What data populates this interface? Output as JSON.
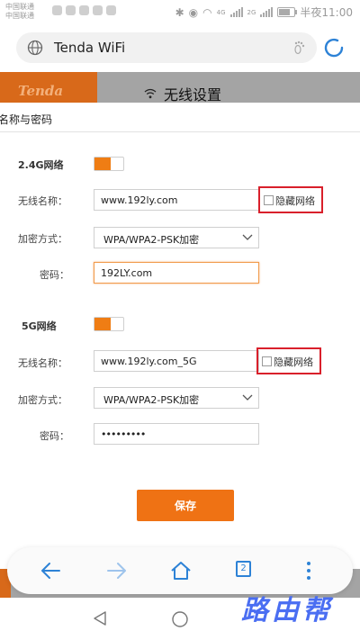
{
  "status_bar": {
    "carrier1": "中国联通",
    "carrier2": "中国联通",
    "network1": "4G",
    "network2": "2G",
    "time": "半夜11:00"
  },
  "browser": {
    "url": "Tenda WiFi",
    "tab_count": "2"
  },
  "page": {
    "header_title": "无线设置",
    "panel_title": "名称与密码",
    "band_24": {
      "label": "2.4G网络",
      "enabled": true,
      "ssid_label": "无线名称：",
      "ssid": "www.192ly.com",
      "hide_label": "隐藏网络",
      "encryption_label": "加密方式：",
      "encryption": "WPA/WPA2-PSK加密",
      "password_label": "密码：",
      "password": "192LY.com"
    },
    "band_5": {
      "label": "5G网络",
      "enabled": true,
      "ssid_label": "无线名称：",
      "ssid": "www.192ly.com_5G",
      "hide_label": "隐藏网络",
      "encryption_label": "加密方式：",
      "encryption": "WPA/WPA2-PSK加密",
      "password_label": "密码：",
      "password_masked": "•••••••••"
    },
    "save_label": "保存"
  },
  "logo_text": "Tenda",
  "watermark": "路由帮",
  "colors": {
    "accent": "#ef7214",
    "highlight": "#d9202b",
    "browser_blue": "#2d82d6"
  }
}
